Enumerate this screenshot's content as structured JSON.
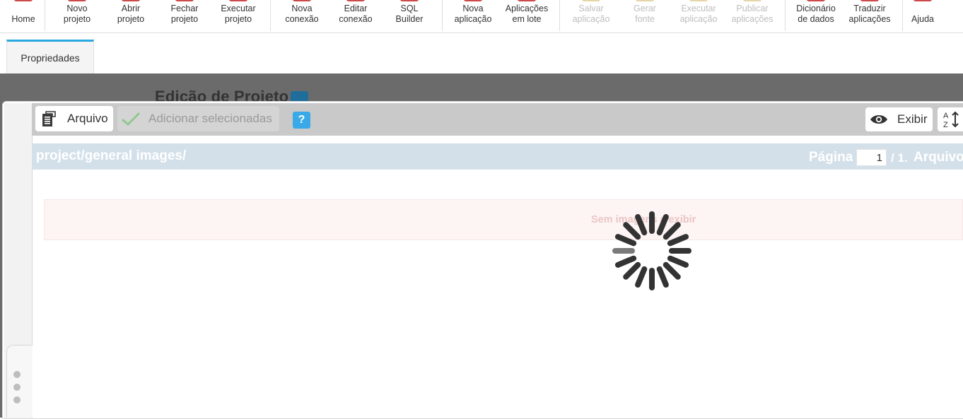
{
  "toolbar": {
    "items": [
      {
        "label": "Home",
        "enabled": true
      },
      {
        "label": "Novo\nprojeto",
        "enabled": true
      },
      {
        "label": "Abrir\nprojeto",
        "enabled": true
      },
      {
        "label": "Fechar\nprojeto",
        "enabled": true
      },
      {
        "label": "Executar\nprojeto",
        "enabled": true
      },
      {
        "label": "Nova\nconexão",
        "enabled": true
      },
      {
        "label": "Editar\nconexão",
        "enabled": true
      },
      {
        "label": "SQL\nBuilder",
        "enabled": true
      },
      {
        "label": "Nova\naplicação",
        "enabled": true
      },
      {
        "label": "Aplicações\nem lote",
        "enabled": true
      },
      {
        "label": "Salvar\naplicação",
        "enabled": false
      },
      {
        "label": "Gerar\nfonte",
        "enabled": false
      },
      {
        "label": "Executar\naplicação",
        "enabled": false
      },
      {
        "label": "Publicar\naplicações",
        "enabled": false
      },
      {
        "label": "Dicionário\nde dados",
        "enabled": true
      },
      {
        "label": "Traduzir\naplicações",
        "enabled": true
      },
      {
        "label": "Ajuda",
        "enabled": true
      }
    ]
  },
  "tabs": {
    "properties": "Propriedades"
  },
  "background": {
    "title": "Edição de Projeto"
  },
  "dialog": {
    "file_button": "Arquivo",
    "add_selected_button": "Adicionar selecionadas",
    "help": "?",
    "view_button": "Exibir",
    "sort_icon_text": "A\nZ",
    "path": "project/general images/",
    "page_label": "Página",
    "page_value": "1",
    "page_total": "/ 1.",
    "files_label": "Arquivo",
    "empty_message": "Sem imagens a exibir"
  },
  "colors": {
    "accent": "#28a8e0",
    "help_button": "#3aa9e8",
    "path_bar": "#d4e0e9",
    "backdrop": "#6b6b6b",
    "empty_bg": "#fdf4f4"
  }
}
